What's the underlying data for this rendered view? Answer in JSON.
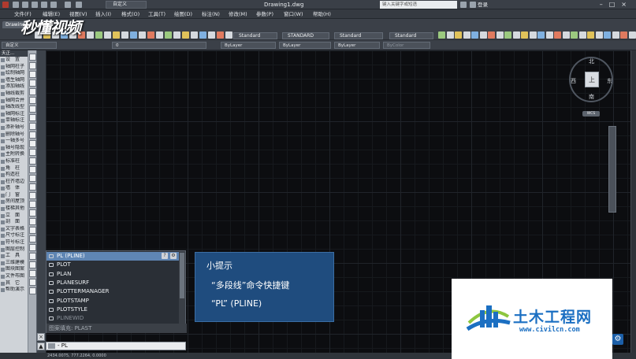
{
  "titlebar": {
    "workspace": "自定义",
    "document": "Drawing1.dwg",
    "search_placeholder": "键入关键字或短语",
    "login": "登录",
    "window_buttons": "–□×"
  },
  "menubar": {
    "items": [
      "文件(F)",
      "编辑(E)",
      "视图(V)",
      "插入(I)",
      "格式(O)",
      "工具(T)",
      "绘图(D)",
      "标注(N)",
      "修改(M)",
      "参数(P)",
      "窗口(W)",
      "帮助(H)"
    ]
  },
  "toolbar": {
    "drawing_tab": "Drawing",
    "layer_value": "自定义",
    "layer_number": "0",
    "text_style": "Standard",
    "dim_style": "STANDARD",
    "table_style": "Standard",
    "multileader_style": "Standard",
    "color": "ByLayer",
    "linetype": "ByLayer",
    "lineweight": "ByLayer",
    "plotstyle": "ByColor"
  },
  "brand": "秒懂视频",
  "left_panel": {
    "header": "天正...",
    "items": [
      "设　置",
      "轴网柱子",
      "绘制轴网",
      "墙生轴网",
      "添加轴线",
      "轴线裁剪",
      "轴网合并",
      "轴改线型",
      "轴网标注",
      "单轴标注",
      "添补轴号",
      "删除轴号",
      "一轴多号",
      "轴号隐现",
      "主附转换",
      "标准柱",
      "角　柱",
      "构造柱",
      "柱齐墙边",
      "墙　体",
      "门　窗",
      "房间屋顶",
      "楼梯其他",
      "立　面",
      "剖　面",
      "文字表格",
      "尺寸标注",
      "符号标注",
      "图层控制",
      "工　具",
      "三维建模",
      "图块图案",
      "文件布图",
      "其　它",
      "帮助演示"
    ]
  },
  "viewcube": {
    "north": "北",
    "south": "南",
    "east": "东",
    "west": "西",
    "face": "上",
    "wcs": "WCS"
  },
  "autocomplete": {
    "items": [
      {
        "label": "PL (PLINE)",
        "selected": true
      },
      {
        "label": "PLOT"
      },
      {
        "label": "PLAN"
      },
      {
        "label": "PLANESURF"
      },
      {
        "label": "PLOTTERMANAGER"
      },
      {
        "label": "PLOTSTAMP"
      },
      {
        "label": "PLOTSTYLE"
      },
      {
        "label": "PLINEWID",
        "dim": true
      }
    ],
    "footer": "图案填充: PLAST",
    "help_btn": "?",
    "settings_btn": "⚙"
  },
  "command_line": {
    "value": "- PL"
  },
  "tip": {
    "title": "小提示",
    "line1": "“多段线”命令快捷键",
    "line2": "“PL” (PLINE)"
  },
  "logo": {
    "name": "土木工程网",
    "url": "www.civilcn.com"
  },
  "status": {
    "coords": "2434.0075, 777.2264, 0.0000"
  }
}
